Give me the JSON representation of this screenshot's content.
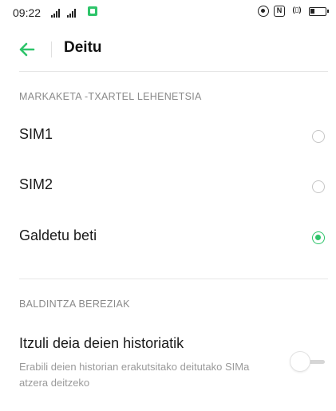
{
  "status_bar": {
    "time": "09:22",
    "icons": [
      "signal-icon",
      "signal-icon",
      "app-notification-icon",
      "hotspot-icon",
      "nfc-icon",
      "vibrate-icon",
      "battery-icon"
    ]
  },
  "header": {
    "back_icon": "arrow-left-icon",
    "title": "Deitu"
  },
  "section_sim": {
    "header": "MARKAKETA -TXARTEL LEHENETSIA",
    "options": [
      {
        "label": "SIM1",
        "selected": false
      },
      {
        "label": "SIM2",
        "selected": false
      },
      {
        "label": "Galdetu beti",
        "selected": true
      }
    ]
  },
  "section_special": {
    "header": "BALDINTZA BEREZIAK",
    "toggle_item": {
      "title": "Itzuli deia deien historiatik",
      "description": "Erabili deien historian erakutsitako deitutako SIMa atzera deitzeko",
      "enabled": false
    }
  },
  "colors": {
    "accent": "#2ec46a",
    "text_primary": "#1a1a1a",
    "text_secondary": "#8a8a8a",
    "divider": "#e6e6e6"
  }
}
